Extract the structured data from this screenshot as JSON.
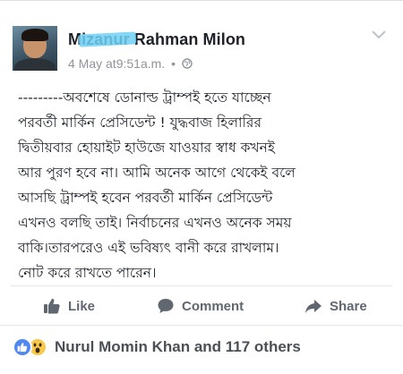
{
  "post": {
    "author": "Mizanur Rahman Milon",
    "date": "4 May",
    "at": "at",
    "time": "9:51a.m.",
    "separator": "•",
    "audience_icon": "globe-icon",
    "lines": [
      "---------অবশেষে ডোনাল্ড ট্রাম্পই হতে যাচ্ছেন",
      "পরবর্তী মার্কিন প্রেসিডেন্ট ! যুদ্ধবাজ হিলারির",
      "দ্বিতীয়বার হোয়াইট হাউজে যাওয়ার স্বাধ কখনই",
      "আর পুরণ হবে না। আমি অনেক আগে থেকেই বলে",
      "আসছি ট্রাম্পই হবেন পরবর্তী  মার্কিন প্রেসিডেন্ট",
      "এখনও বলছি তাই।  নির্বাচনের এখনও অনেক সময়",
      "বাকি।তারপরেও এই ভবিষ্যৎ বানী করে রাখলাম।",
      "নোট করে রাখতে পারেন।"
    ]
  },
  "actions": {
    "like": "Like",
    "comment": "Comment",
    "share": "Share"
  },
  "reactions": {
    "summary": "Nurul Momin Khan and 117 others",
    "icons": [
      "like-reaction-icon",
      "wow-reaction-icon"
    ]
  },
  "colors": {
    "text": "#1d2129",
    "meta": "#90949c",
    "action": "#606770",
    "like_blue": "#4e88f0",
    "wow_yellow": "#f7c84a",
    "highlight": "#6fd0f4"
  }
}
